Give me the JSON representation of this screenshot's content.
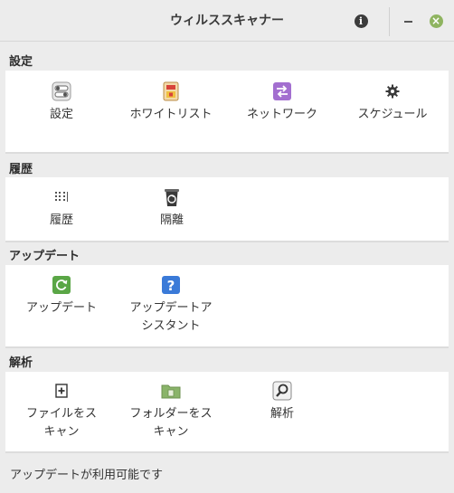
{
  "window": {
    "title": "ウィルススキャナー"
  },
  "sections": [
    {
      "label": "設定",
      "items": [
        {
          "label": "設定",
          "icon": "toggle-settings-icon"
        },
        {
          "label": "ホワイトリスト",
          "icon": "shield-whitelist-icon"
        },
        {
          "label": "ネットワーク",
          "icon": "network-arrows-icon"
        },
        {
          "label": "スケジュール",
          "icon": "gear-icon"
        }
      ]
    },
    {
      "label": "履歴",
      "items": [
        {
          "label": "履歴",
          "icon": "history-list-icon"
        },
        {
          "label": "隔離",
          "icon": "trash-recycle-icon"
        }
      ]
    },
    {
      "label": "アップデート",
      "items": [
        {
          "label": "アップデート",
          "icon": "refresh-icon"
        },
        {
          "label": "アップデートア\nシスタント",
          "icon": "question-icon"
        }
      ]
    },
    {
      "label": "解析",
      "items": [
        {
          "label": "ファイルをス\nキャン",
          "icon": "file-add-icon"
        },
        {
          "label": "フォルダーをス\nキャン",
          "icon": "folder-icon"
        },
        {
          "label": "解析",
          "icon": "magnifier-icon"
        }
      ]
    }
  ],
  "status": "アップデートが利用可能です",
  "colors": {
    "green": "#5aa646",
    "blue": "#3a7ad8",
    "purple": "#a36fd0",
    "red": "#d8433a",
    "folder_green": "#8ab46a"
  }
}
